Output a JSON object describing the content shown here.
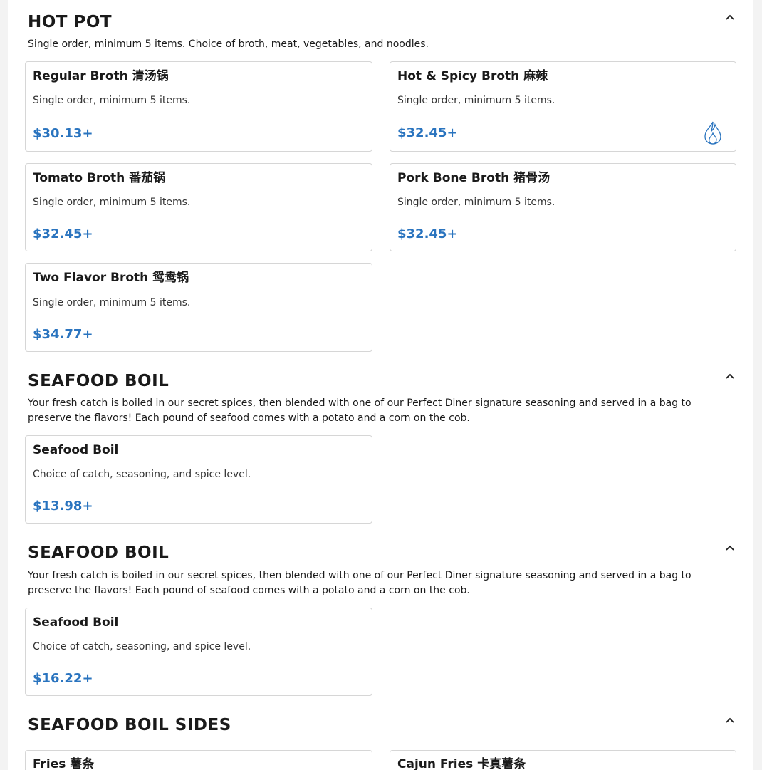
{
  "sections": [
    {
      "title": "HOT POT",
      "description": "Single order, minimum 5 items. Choice of broth, meat, vegetables, and noodles.",
      "items": [
        {
          "name": "Regular Broth 清汤锅",
          "description": "Single order, minimum 5 items.",
          "price": "$30.13+"
        },
        {
          "name": "Hot & Spicy Broth 麻辣",
          "description": "Single order, minimum 5 items.",
          "price": "$32.45+",
          "icon": "flame-icon"
        },
        {
          "name": "Tomato Broth 番茄锅",
          "description": "Single order, minimum 5 items.",
          "price": "$32.45+"
        },
        {
          "name": "Pork Bone Broth 猪骨汤",
          "description": "Single order, minimum 5 items.",
          "price": "$32.45+"
        },
        {
          "name": "Two Flavor Broth 鸳鸯锅",
          "description": "Single order, minimum 5 items.",
          "price": "$34.77+"
        }
      ]
    },
    {
      "title": "SEAFOOD BOIL",
      "description": "Your fresh catch is boiled in our secret spices, then blended with one of our Perfect Diner signature seasoning and served in a bag to preserve the flavors! Each pound of seafood comes with a potato and a corn on the cob.",
      "items": [
        {
          "name": "Seafood Boil",
          "description": "Choice of catch, seasoning, and spice level.",
          "price": "$13.98+"
        }
      ]
    },
    {
      "title": "SEAFOOD BOIL",
      "description": "Your fresh catch is boiled in our secret spices, then blended with one of our Perfect Diner signature seasoning and served in a bag to preserve the flavors! Each pound of seafood comes with a potato and a corn on the cob.",
      "items": [
        {
          "name": "Seafood Boil",
          "description": "Choice of catch, seasoning, and spice level.",
          "price": "$16.22+"
        }
      ]
    },
    {
      "title": "SEAFOOD BOIL SIDES",
      "items": [
        {
          "name": "Fries 薯条"
        },
        {
          "name": "Cajun Fries 卡真薯条"
        }
      ]
    }
  ],
  "colors": {
    "price": "#2a74bf",
    "border": "#d6d6d6"
  },
  "icons": {
    "collapse": "chevron-up-icon",
    "spicy": "flame-icon"
  }
}
